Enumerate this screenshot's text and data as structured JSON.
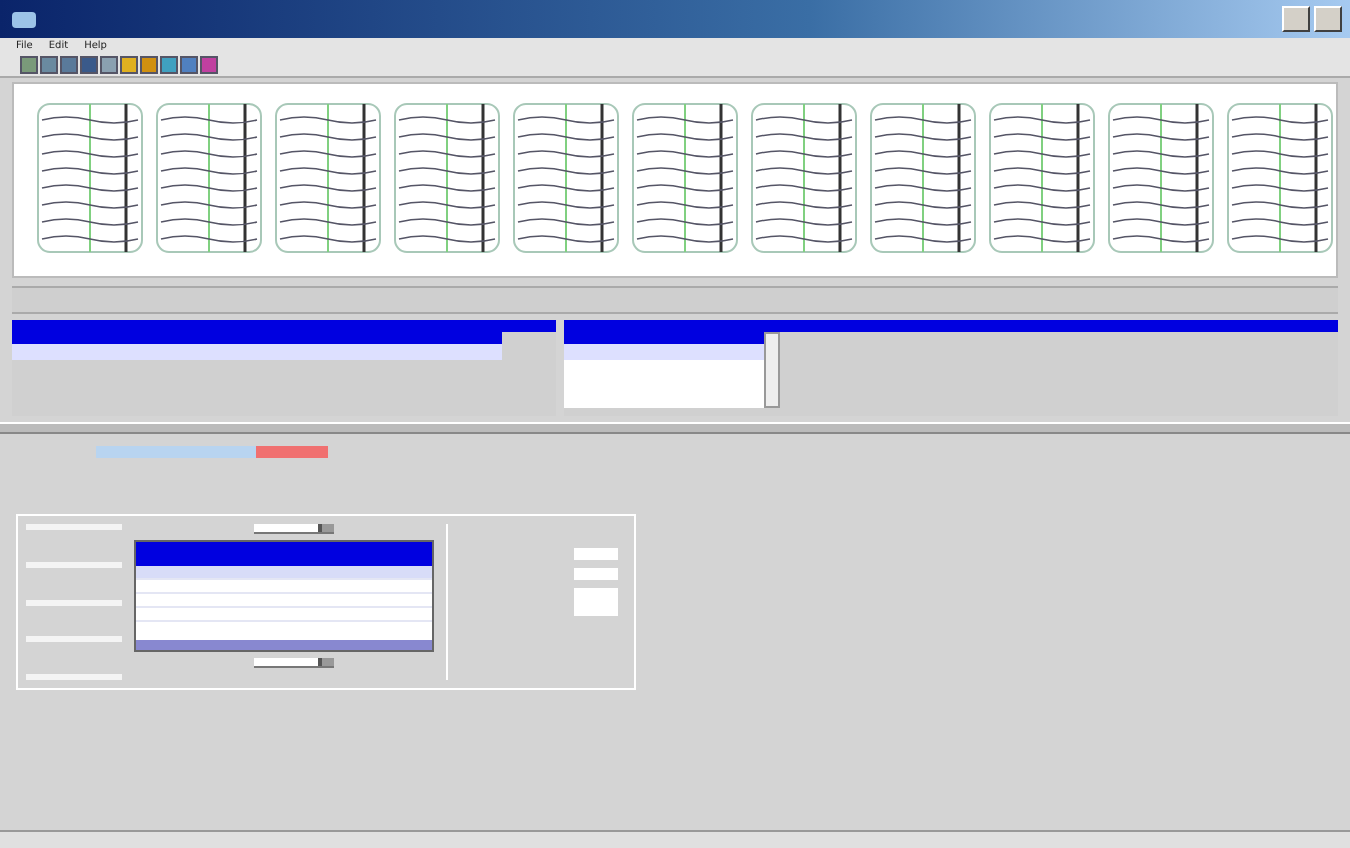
{
  "menu": [
    "File",
    "Edit",
    "Help"
  ],
  "sliders": [
    {
      "level": 0.85
    },
    {
      "level": 0.85
    }
  ],
  "value_rows": [
    {
      "selected": true
    },
    {
      "selected": false
    },
    {
      "selected": false
    },
    {
      "selected": false
    }
  ],
  "grid_rows": [
    {
      "selected": true
    },
    {
      "selected": false
    },
    {
      "selected": false
    },
    {
      "selected": false
    }
  ]
}
